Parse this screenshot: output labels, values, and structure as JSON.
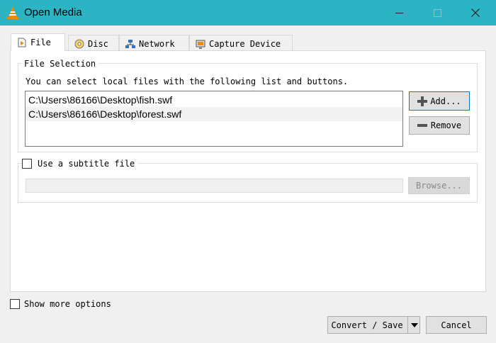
{
  "window": {
    "title": "Open Media",
    "app_icon": "vlc-cone-icon",
    "controls": [
      "minimize",
      "maximize",
      "close"
    ],
    "accent": "#2ab4c4"
  },
  "tabs": [
    {
      "label": "File",
      "icon": "file-icon",
      "active": true
    },
    {
      "label": "Disc",
      "icon": "disc-icon",
      "active": false
    },
    {
      "label": "Network",
      "icon": "network-icon",
      "active": false
    },
    {
      "label": "Capture Device",
      "icon": "capture-device-icon",
      "active": false
    }
  ],
  "file_selection": {
    "legend": "File Selection",
    "hint": "You can select local files with the following list and buttons.",
    "files": [
      "C:\\Users\\86166\\Desktop\\fish.swf",
      "C:\\Users\\86166\\Desktop\\forest.swf"
    ],
    "add_label": "Add...",
    "remove_label": "Remove"
  },
  "subtitle": {
    "label": "Use a subtitle file",
    "checked": false,
    "path_value": "",
    "browse_label": "Browse...",
    "enabled": false
  },
  "footer": {
    "show_more_label": "Show more options",
    "show_more_checked": false,
    "convert_label": "Convert / Save",
    "cancel_label": "Cancel"
  }
}
